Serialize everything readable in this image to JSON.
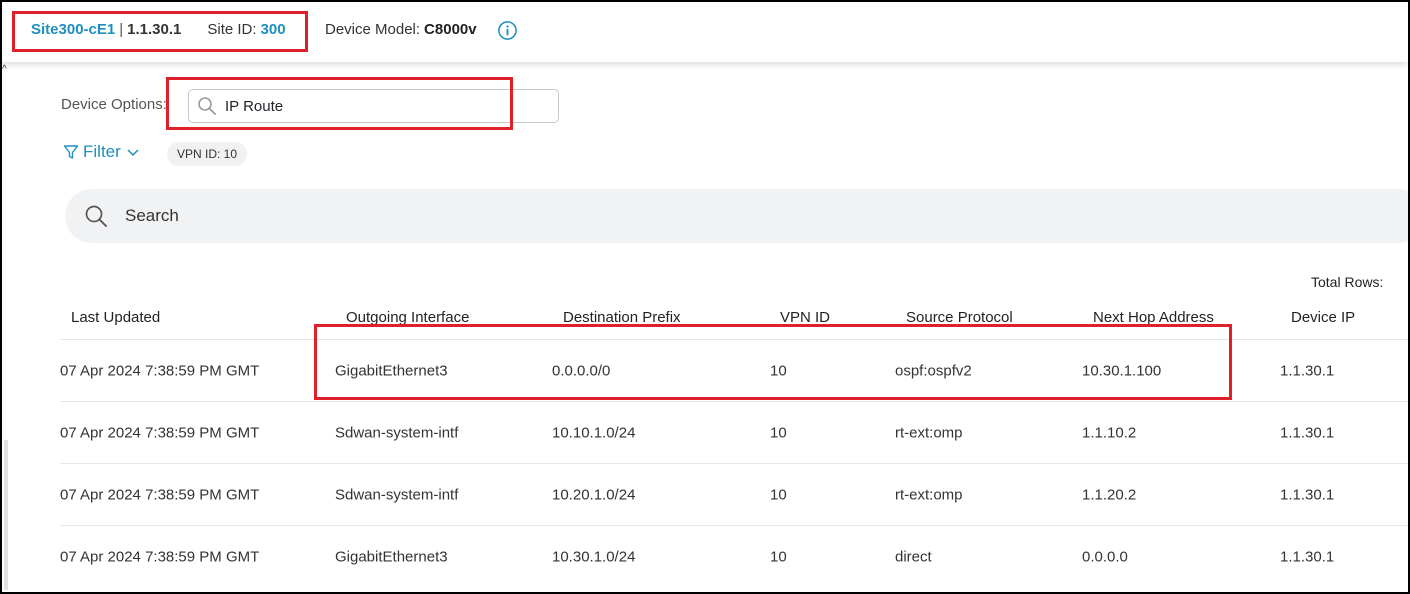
{
  "header": {
    "site_name": "Site300-cE1",
    "separator": "|",
    "system_ip": "1.1.30.1",
    "site_id_label": "Site ID:",
    "site_id_value": "300",
    "device_model_label": "Device Model:",
    "device_model_value": "C8000v",
    "info_icon": "info-circle-icon"
  },
  "device_options": {
    "label": "Device Options:",
    "value": "IP Route",
    "icon": "search-icon"
  },
  "filter": {
    "label": "Filter",
    "icon": "funnel-icon",
    "chip": "VPN ID:  10"
  },
  "search": {
    "placeholder": "Search",
    "icon": "search-icon"
  },
  "table": {
    "total_rows_label": "Total Rows:",
    "columns": [
      "Last Updated",
      "Outgoing Interface",
      "Destination Prefix",
      "VPN ID",
      "Source Protocol",
      "Next Hop Address",
      "Device IP"
    ],
    "rows": [
      [
        "07 Apr 2024 7:38:59 PM GMT",
        "GigabitEthernet3",
        "0.0.0.0/0",
        "10",
        "ospf:ospfv2",
        "10.30.1.100",
        "1.1.30.1"
      ],
      [
        "07 Apr 2024 7:38:59 PM GMT",
        "Sdwan-system-intf",
        "10.10.1.0/24",
        "10",
        "rt-ext:omp",
        "1.1.10.2",
        "1.1.30.1"
      ],
      [
        "07 Apr 2024 7:38:59 PM GMT",
        "Sdwan-system-intf",
        "10.20.1.0/24",
        "10",
        "rt-ext:omp",
        "1.1.20.2",
        "1.1.30.1"
      ],
      [
        "07 Apr 2024 7:38:59 PM GMT",
        "GigabitEthernet3",
        "10.30.1.0/24",
        "10",
        "direct",
        "0.0.0.0",
        "1.1.30.1"
      ]
    ]
  },
  "colors": {
    "accent": "#1e8fbf",
    "highlight": "#e0202a"
  }
}
